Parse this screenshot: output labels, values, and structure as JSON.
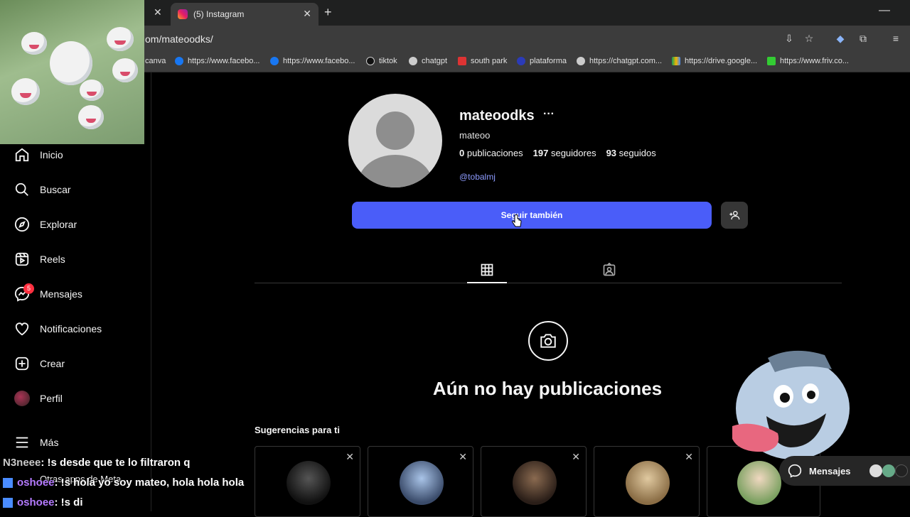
{
  "browser": {
    "tab_title": "(5) Instagram",
    "url": "om/mateoodks/",
    "bookmarks": [
      "canva",
      "https://www.facebo...",
      "https://www.facebo...",
      "tiktok",
      "chatgpt",
      "south park",
      "plataforma",
      "https://chatgpt.com...",
      "https://drive.google...",
      "https://www.friv.co..."
    ]
  },
  "sidebar": {
    "items": [
      {
        "label": "Inicio",
        "icon": "home-icon"
      },
      {
        "label": "Buscar",
        "icon": "search-icon"
      },
      {
        "label": "Explorar",
        "icon": "compass-icon"
      },
      {
        "label": "Reels",
        "icon": "reels-icon"
      },
      {
        "label": "Mensajes",
        "icon": "messenger-icon"
      },
      {
        "label": "Notificaciones",
        "icon": "heart-icon"
      },
      {
        "label": "Crear",
        "icon": "plus-square-icon"
      },
      {
        "label": "Perfil",
        "icon": "avatar"
      },
      {
        "label": "Más",
        "icon": "menu-icon"
      }
    ],
    "messages_badge": "5",
    "other_apps": "Otras apps de Meta"
  },
  "profile": {
    "username": "mateoodks",
    "more": "···",
    "full_name": "mateoo",
    "posts_count": "0",
    "posts_label": "publicaciones",
    "followers_count": "197",
    "followers_label": "seguidores",
    "following_count": "93",
    "following_label": "seguidos",
    "tag_link": "@tobalmj",
    "follow_button": "Seguir también"
  },
  "empty_state": "Aún no hay publicaciones",
  "suggestions": {
    "title": "Sugerencias para ti",
    "close": "✕"
  },
  "messages_pill": "Mensajes",
  "chat": [
    {
      "user": "N3neee",
      "text": " : !s desde que te lo filtraron q"
    },
    {
      "user": "oshoee",
      "text": " : !s hola yo soy mateo, hola hola hola"
    },
    {
      "user": "oshoee",
      "text": " : !s di"
    }
  ],
  "colors": {
    "accent": "#4a5df9",
    "link": "#8e9cff",
    "badge": "#ff3040"
  }
}
